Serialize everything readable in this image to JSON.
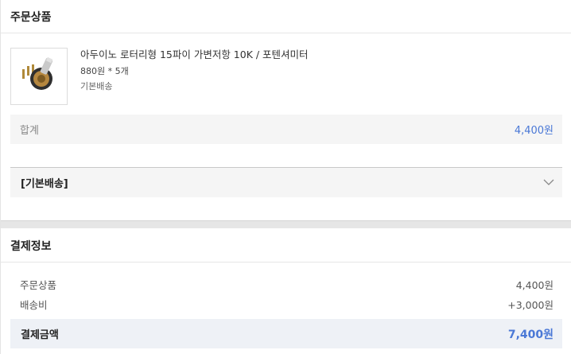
{
  "order": {
    "title": "주문상품",
    "product": {
      "name": "아두이노 로터리형 15파이 가변저항 10K / 포텐셔미터",
      "qty": "880원 * 5개",
      "shipping": "기본배송"
    },
    "total_label": "합계",
    "total_value": "4,400원",
    "shipping_group": "[기본배송]"
  },
  "payment": {
    "title": "결제정보",
    "rows": [
      {
        "label": "주문상품",
        "value": "4,400원"
      },
      {
        "label": "배송비",
        "value": "+3,000원"
      }
    ],
    "total_label": "결제금액",
    "total_value": "7,400원"
  },
  "colors": {
    "accent": "#4a78d6"
  }
}
